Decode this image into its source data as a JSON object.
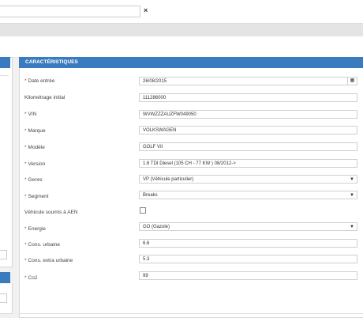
{
  "topbar": {
    "clear_symbol": "×"
  },
  "section": {
    "title": "CARACTÉRISTIQUES"
  },
  "fields": {
    "date_entree": {
      "label": "Date entrée",
      "required": true,
      "value": "26/08/2015",
      "icon": "calendar-icon"
    },
    "kilometrage": {
      "label": "Kilométrage initial",
      "required": false,
      "value": "111286000"
    },
    "vin": {
      "label": "VIN",
      "required": true,
      "value": "WVWZZZAUZFW049050"
    },
    "marque": {
      "label": "Marque",
      "required": true,
      "value": "VOLKSWAGEN"
    },
    "modele": {
      "label": "Modèle",
      "required": true,
      "value": "GOLF VII"
    },
    "version": {
      "label": "Version",
      "required": true,
      "value": "1.6 TDI Diesel (105 CH - 77 KW ) 08/2012->"
    },
    "genre": {
      "label": "Genre",
      "required": true,
      "value": "VP (Véhicule particulier)",
      "caret": "▼"
    },
    "segment": {
      "label": "Segment",
      "required": true,
      "value": "Breaks",
      "caret": "▼"
    },
    "aen": {
      "label": "Véhicule soumis à AEN",
      "required": false,
      "checked": false
    },
    "energie": {
      "label": "Energie",
      "required": true,
      "value": "GO (Gazole)",
      "caret": "▼"
    },
    "cons_urbaine": {
      "label": "Cons. urbaine",
      "required": true,
      "value": "6.6"
    },
    "cons_extra": {
      "label": "Cons. extra urbaine",
      "required": true,
      "value": "5.3"
    },
    "co2": {
      "label": "Co2",
      "required": true,
      "value": "99"
    }
  },
  "required_marker": "*",
  "calendar_glyph": "▦",
  "colors": {
    "header_blue": "#3a7abf",
    "required_red": "#c0392b"
  }
}
